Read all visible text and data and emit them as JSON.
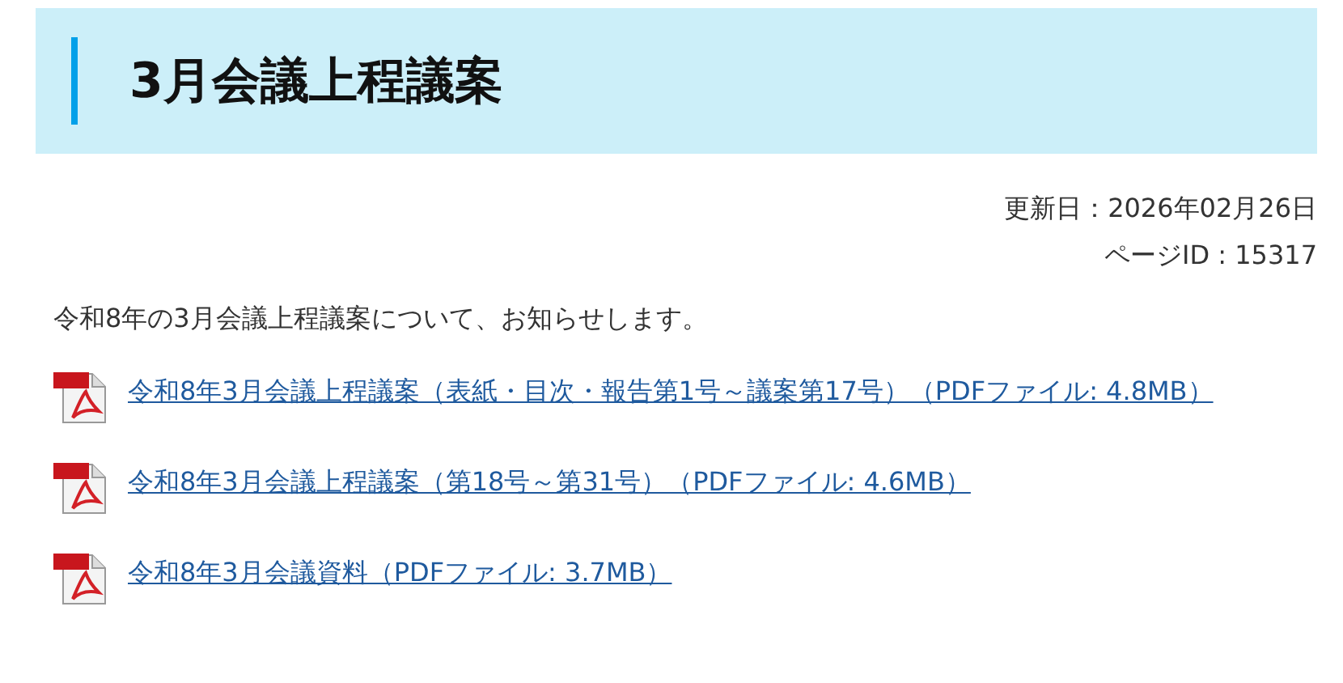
{
  "heading": "3月会議上程議案",
  "updated": "更新日：2026年02月26日",
  "page_id": "ページID : 15317",
  "intro": "令和8年の3月会議上程議案について、お知らせします。",
  "files": [
    {
      "kind": "pdf",
      "label": "令和8年3月会議上程議案（表紙・目次・報告第1号～議案第17号）（PDFファイル: 4.8MB）"
    },
    {
      "kind": "pdf",
      "label": "令和8年3月会議上程議案（第18号～第31号）（PDFファイル: 4.6MB）"
    },
    {
      "kind": "pdf",
      "label": "令和8年3月会議資料（PDFファイル: 3.7MB）"
    }
  ]
}
